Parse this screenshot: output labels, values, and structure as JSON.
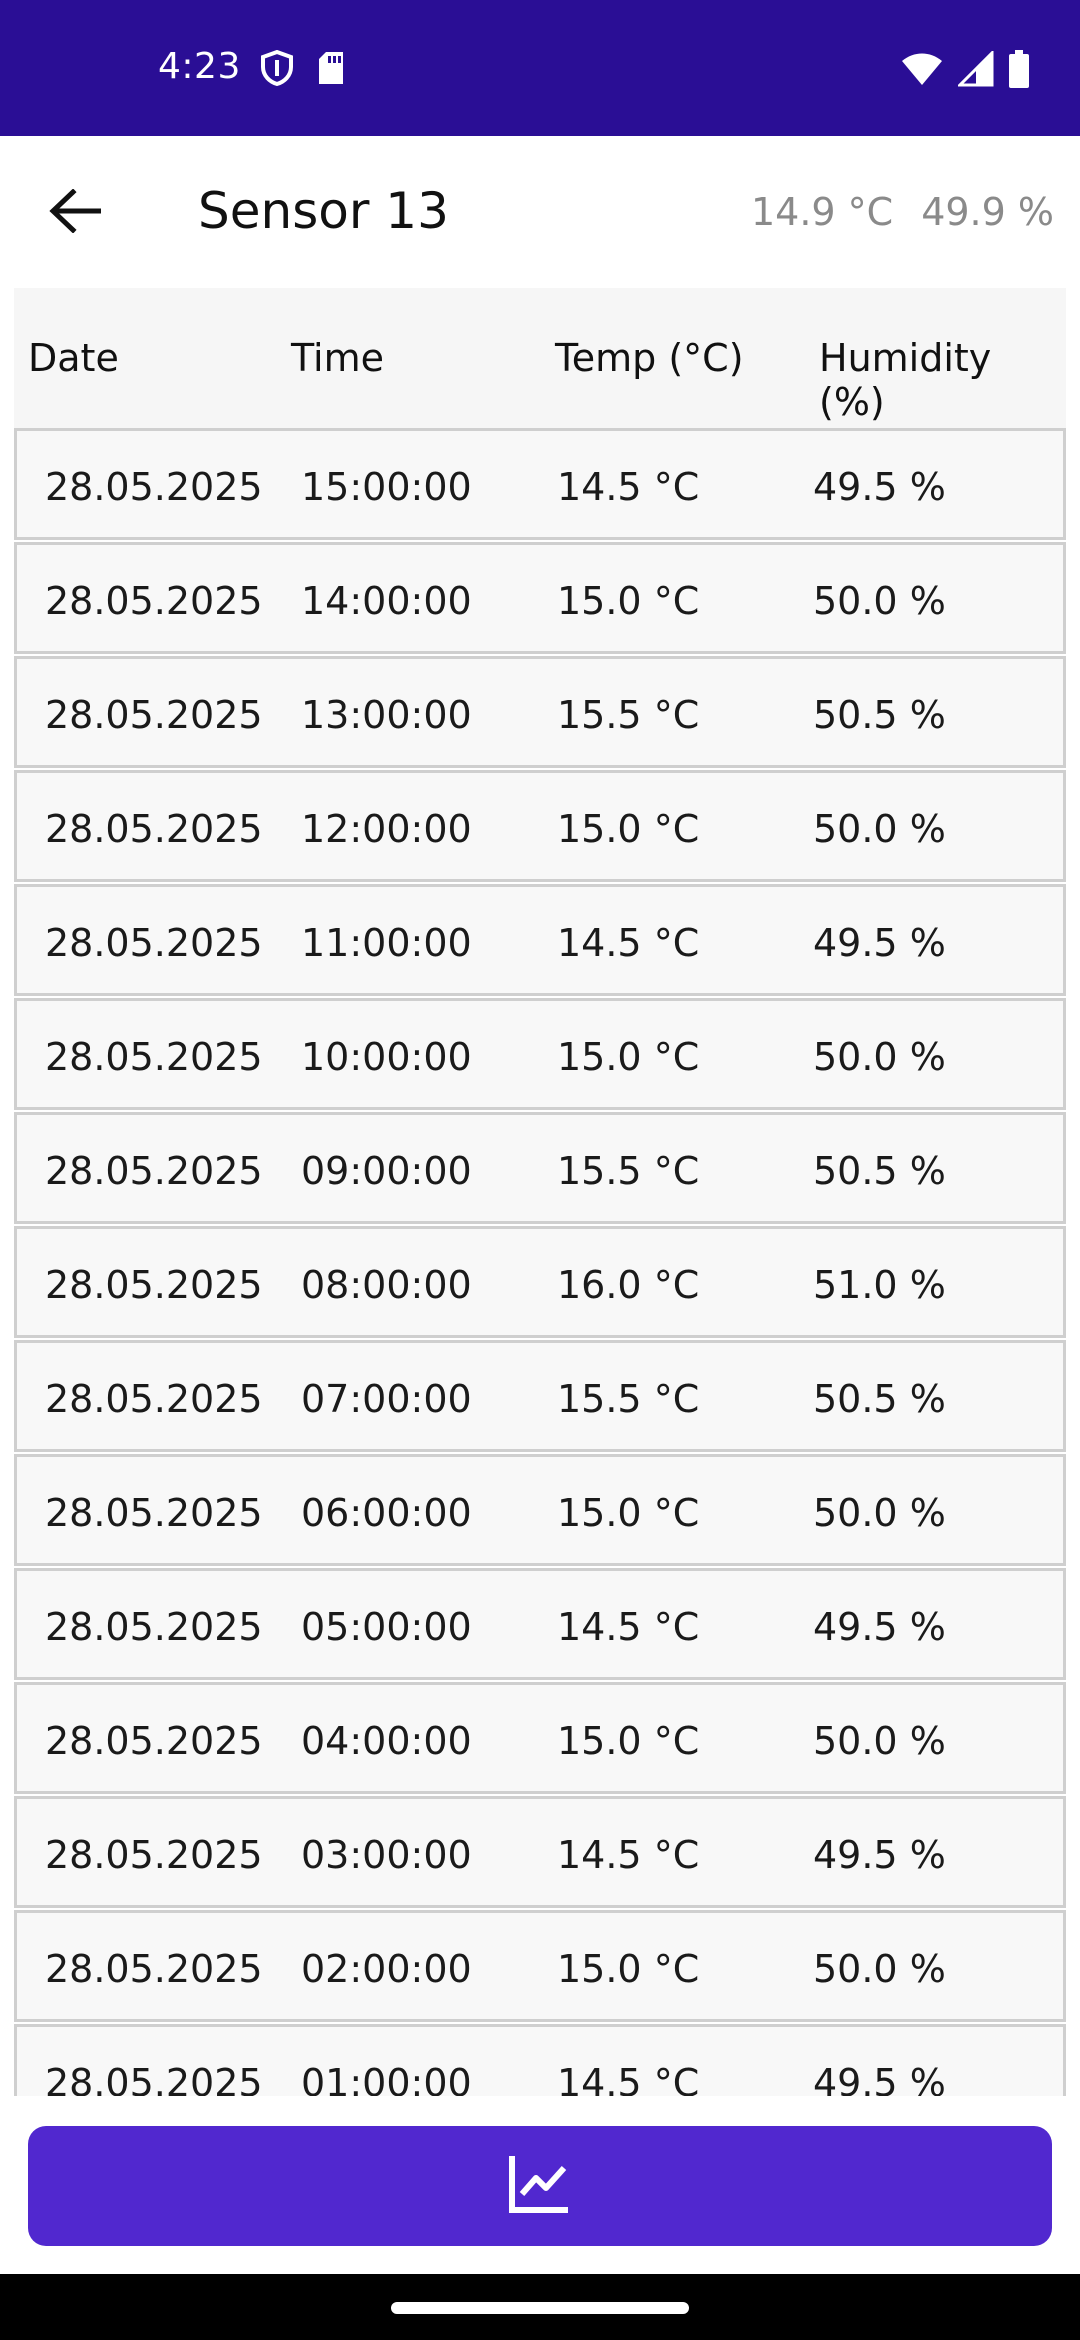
{
  "status_bar": {
    "time": "4:23",
    "left_icons": [
      "shield-icon",
      "sd-card-icon"
    ],
    "right_icons": [
      "wifi-icon",
      "cell-signal-icon",
      "battery-icon"
    ],
    "background": "#2a0e95"
  },
  "app_bar": {
    "title": "Sensor 13",
    "temperature": "14.9 °C",
    "humidity": "49.9 %"
  },
  "table": {
    "headers": [
      "Date",
      "Time",
      "Temp (°C)",
      "Humidity (%)"
    ],
    "rows": [
      {
        "date": "28.05.2025",
        "time": "15:00:00",
        "temp": "14.5 °C",
        "humidity": "49.5 %"
      },
      {
        "date": "28.05.2025",
        "time": "14:00:00",
        "temp": "15.0 °C",
        "humidity": "50.0 %"
      },
      {
        "date": "28.05.2025",
        "time": "13:00:00",
        "temp": "15.5 °C",
        "humidity": "50.5 %"
      },
      {
        "date": "28.05.2025",
        "time": "12:00:00",
        "temp": "15.0 °C",
        "humidity": "50.0 %"
      },
      {
        "date": "28.05.2025",
        "time": "11:00:00",
        "temp": "14.5 °C",
        "humidity": "49.5 %"
      },
      {
        "date": "28.05.2025",
        "time": "10:00:00",
        "temp": "15.0 °C",
        "humidity": "50.0 %"
      },
      {
        "date": "28.05.2025",
        "time": "09:00:00",
        "temp": "15.5 °C",
        "humidity": "50.5 %"
      },
      {
        "date": "28.05.2025",
        "time": "08:00:00",
        "temp": "16.0 °C",
        "humidity": "51.0 %"
      },
      {
        "date": "28.05.2025",
        "time": "07:00:00",
        "temp": "15.5 °C",
        "humidity": "50.5 %"
      },
      {
        "date": "28.05.2025",
        "time": "06:00:00",
        "temp": "15.0 °C",
        "humidity": "50.0 %"
      },
      {
        "date": "28.05.2025",
        "time": "05:00:00",
        "temp": "14.5 °C",
        "humidity": "49.5 %"
      },
      {
        "date": "28.05.2025",
        "time": "04:00:00",
        "temp": "15.0 °C",
        "humidity": "50.0 %"
      },
      {
        "date": "28.05.2025",
        "time": "03:00:00",
        "temp": "14.5 °C",
        "humidity": "49.5 %"
      },
      {
        "date": "28.05.2025",
        "time": "02:00:00",
        "temp": "15.0 °C",
        "humidity": "50.0 %"
      },
      {
        "date": "28.05.2025",
        "time": "01:00:00",
        "temp": "14.5 °C",
        "humidity": "49.5 %"
      }
    ]
  },
  "chart_button": {
    "icon": "line-chart-icon",
    "color": "#5128cf"
  }
}
